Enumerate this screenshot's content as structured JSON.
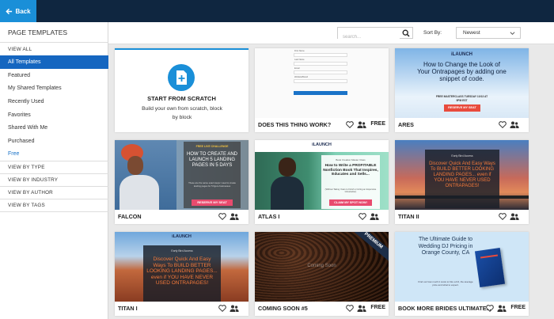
{
  "topbar": {
    "back_label": "Back"
  },
  "sidebar": {
    "header": "PAGE TEMPLATES",
    "view_all": "VIEW ALL",
    "items": [
      "All Templates",
      "Featured",
      "My Shared Templates",
      "Recently Used",
      "Favorites",
      "Shared With Me",
      "Purchased",
      "Free"
    ],
    "sections": [
      "VIEW BY TYPE",
      "VIEW BY INDUSTRY",
      "VIEW BY AUTHOR",
      "VIEW BY TAGS"
    ]
  },
  "filters": {
    "search_placeholder": "search...",
    "sort_label": "Sort By:",
    "sort_value": "Newest"
  },
  "scratch": {
    "title": "START FROM SCRATCH",
    "desc": "Build your own from scratch, block by block"
  },
  "cards": [
    {
      "title": "DOES THIS THING WORK?",
      "free": "FREE"
    },
    {
      "title": "ARES"
    },
    {
      "title": "FALCON"
    },
    {
      "title": "ATLAS I"
    },
    {
      "title": "TITAN II"
    },
    {
      "title": "TITAN I"
    },
    {
      "title": "COMING SOON #5",
      "free": "FREE"
    },
    {
      "title": "BOOK MORE BRIDES ULTIMATE...",
      "free": "FREE"
    }
  ],
  "thumbs": {
    "form_fields": [
      "First Name",
      "Last Name",
      "Email",
      "Website/Brand"
    ],
    "ares": {
      "logo": "iLAUNCH",
      "headline": "How to Change the Look of Your Ontrapages by adding one snippet of code.",
      "sub": "FREE MASTERCLASS TUESDAY 10/13 AT 9PM EST",
      "button": "RESERVE MY SEAT"
    },
    "falcon": {
      "eyebrow": "FREE LIVE CHALLENGE",
      "headline": "HOW TO CREATE AND LAUNCH 5 LANDING PAGES IN 5 DAYS",
      "body": "These are the same exact steps I used to create landing pages for 5 figure businesses",
      "button": "RESERVE MY SEAT"
    },
    "atlas": {
      "logo": "iLAUNCH",
      "eyebrow": "Book Creation Master Class",
      "headline": "How to Write a PROFITABLE Nonfiction Book That Inspires, Educates and Sells...",
      "sub": "(Without Taking Years to Finish or Hiring an Expensive Ghostwriter)",
      "button": "CLAIM MY SPOT NOW!"
    },
    "titan": {
      "logo": "iLAUNCH",
      "eyebrow": "Early Bird Access",
      "headline": "Discover Quick And Easy Ways To BUILD BETTER LOOKING LANDING PAGES... even if YOU HAVE NEVER USED ONTRAPAGES!"
    },
    "coming": {
      "ribbon": "PREMIUM",
      "headline": "Coming Soon"
    },
    "brides": {
      "headline": "The Ultimate Guide to Wedding DJ Pricing in Orange County, CA",
      "body": "Find out how much it costs to hire a DJ, the average price and what to expect."
    }
  },
  "colors": {
    "topbar": "#0f2640",
    "accent": "#1a8fd8",
    "active": "#1566c0",
    "free_link": "#1a73c8",
    "cta_pink": "#e84b6e"
  }
}
